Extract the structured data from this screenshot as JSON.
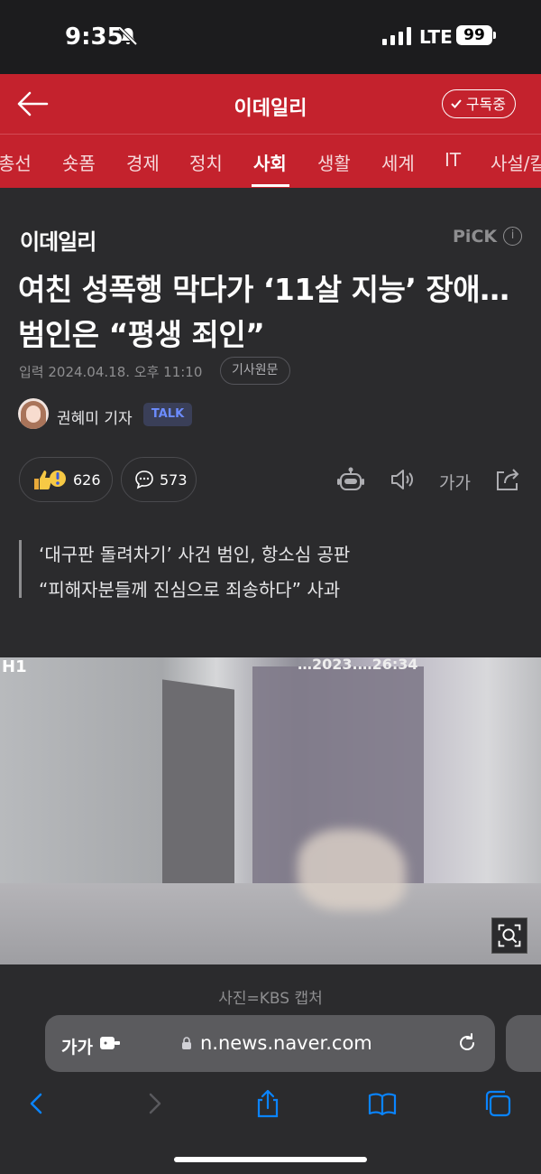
{
  "status_bar": {
    "time": "9:35",
    "network": "LTE",
    "battery": "99"
  },
  "header": {
    "title": "이데일리",
    "subscribe_label": "구독중",
    "back_icon": "arrow-left-icon"
  },
  "tabs": [
    "총선",
    "숏폼",
    "경제",
    "정치",
    "사회",
    "생활",
    "세계",
    "IT",
    "사설/칼"
  ],
  "active_tab": "사회",
  "article": {
    "publisher_logo": "이데일리",
    "pick_label": "PiCK",
    "headline": "여친 성폭행 막다가 ‘11살 지능’ 장애…범인은 “평생 죄인”",
    "meta": "입력 2024.04.18. 오후 11:10",
    "original_button": "기사원문",
    "reporter": "권혜미 기자",
    "talk_badge": "TALK",
    "reactions_count": "626",
    "comments_count": "573",
    "font_button": "가가",
    "subheads": [
      "‘대구판 돌려차기’ 사건 범인, 항소심 공판",
      "“피해자분들께 진심으로 죄송하다” 사과"
    ],
    "photo_caption": "사진=KBS 캡처",
    "photo_overlay_text": "H1",
    "photo_timestamp": "…2023.…26:34"
  },
  "browser": {
    "font_button": "가가",
    "url": "n.news.naver.com"
  },
  "colors": {
    "brand_red": "#c4222d",
    "talk_blue": "#6c8cff",
    "safari_blue": "#0a84ff"
  }
}
